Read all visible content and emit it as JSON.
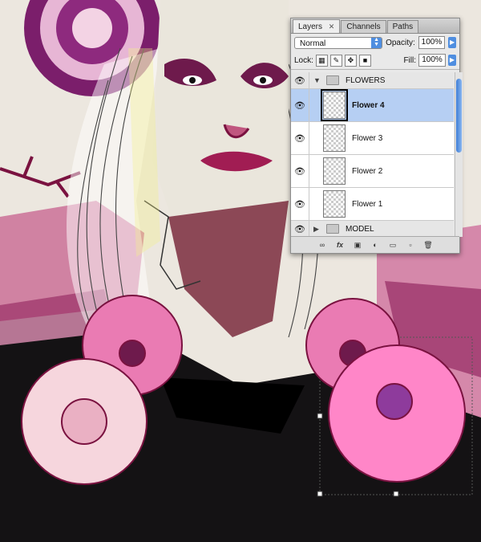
{
  "palette": {
    "tabs": [
      "Layers",
      "Channels",
      "Paths"
    ],
    "close_glyph": "✕",
    "blend_mode": "Normal",
    "opacity_label": "Opacity:",
    "opacity_value": "100%",
    "lock_label": "Lock:",
    "fill_label": "Fill:",
    "fill_value": "100%",
    "layers": [
      {
        "name": "FLOWERS",
        "type": "group",
        "expanded": true
      },
      {
        "name": "Flower 4",
        "type": "layer",
        "selected": true
      },
      {
        "name": "Flower 3",
        "type": "layer"
      },
      {
        "name": "Flower 2",
        "type": "layer"
      },
      {
        "name": "Flower 1",
        "type": "layer"
      },
      {
        "name": "MODEL",
        "type": "group",
        "expanded": false
      }
    ],
    "bottom_labels": {
      "fx": "fx"
    }
  },
  "colors": {
    "accent": "#4f8ee0",
    "selection": "#b6cff3",
    "flower_pink": "#f07bb6",
    "flower_light": "#f6d6dd",
    "magenta_dark": "#8b1a56"
  }
}
